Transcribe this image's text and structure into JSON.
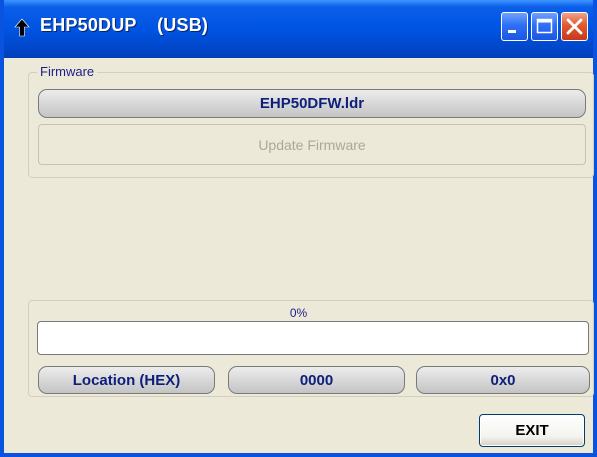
{
  "window": {
    "title": "EHP50DUP    (USB)"
  },
  "firmware": {
    "group_label": "Firmware",
    "file_name": "EHP50DFW.ldr",
    "update_button": "Update Firmware",
    "update_enabled": false
  },
  "progress": {
    "percent_text": "0%",
    "value": 0,
    "location_label": "Location (HEX)",
    "location_value": "0000",
    "data_value": "0x0"
  },
  "actions": {
    "exit_label": "EXIT"
  },
  "colors": {
    "title_bar": "#0054e3",
    "label_text": "#0d1f7a",
    "disabled_text": "#aca899",
    "face": "#ece9d8"
  }
}
